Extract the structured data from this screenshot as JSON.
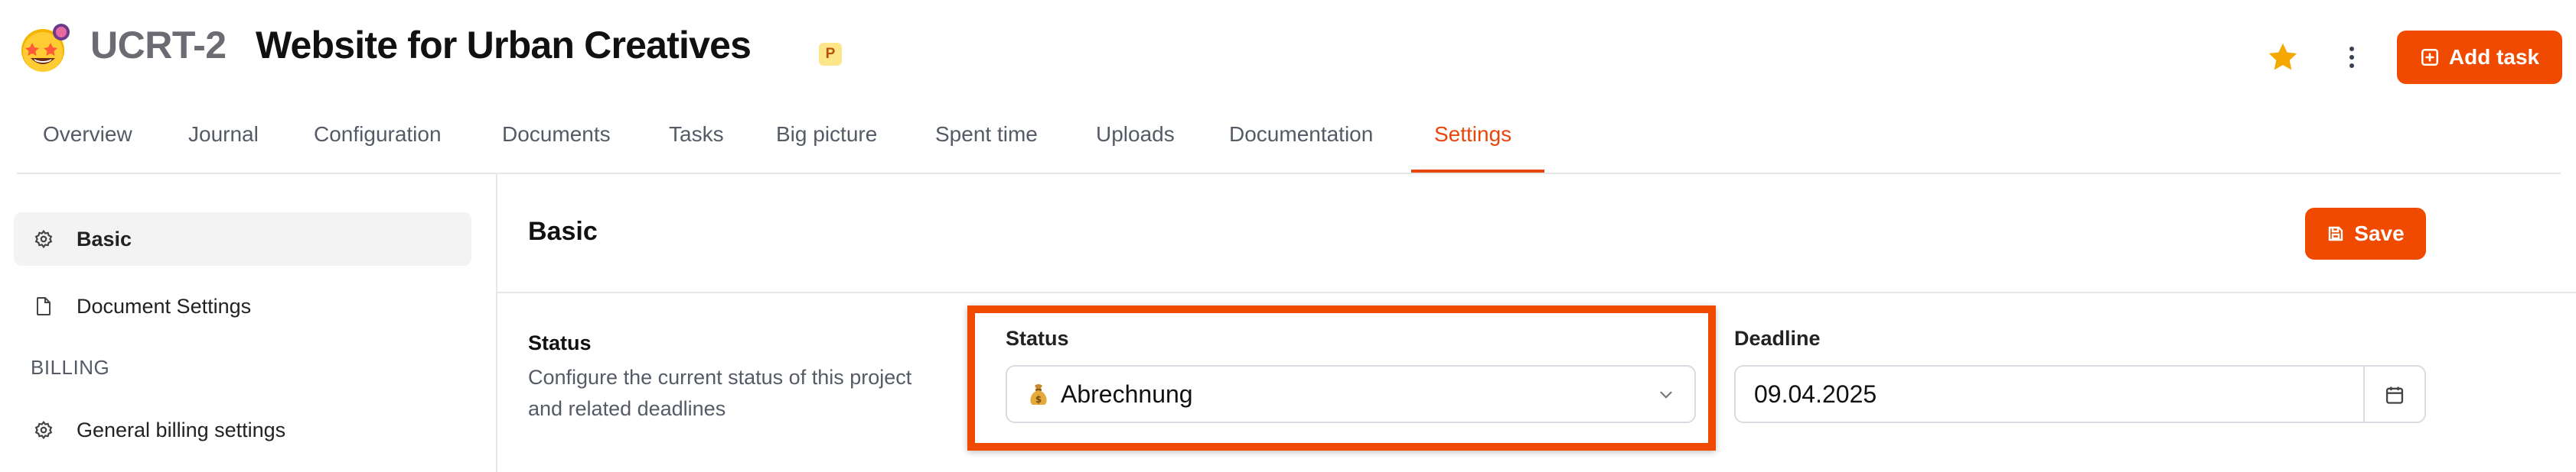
{
  "header": {
    "project_code": "UCRT-2",
    "project_name": "Website for Urban Creatives",
    "badge": "P",
    "avatar_icon": "star-struck-emoji",
    "favorite_icon": "star-icon",
    "more_icon": "kebab-menu-icon",
    "add_task_label": "Add task"
  },
  "tabs": [
    {
      "label": "Overview"
    },
    {
      "label": "Journal"
    },
    {
      "label": "Configuration"
    },
    {
      "label": "Documents"
    },
    {
      "label": "Tasks"
    },
    {
      "label": "Big picture"
    },
    {
      "label": "Spent time"
    },
    {
      "label": "Uploads"
    },
    {
      "label": "Documentation"
    },
    {
      "label": "Settings",
      "active": true
    }
  ],
  "sidebar": {
    "items": [
      {
        "label": "Basic",
        "icon": "gear-icon",
        "active": true
      },
      {
        "label": "Document Settings",
        "icon": "document-icon"
      }
    ],
    "section_billing": "BILLING",
    "billing_items": [
      {
        "label": "General billing settings",
        "icon": "gear-icon"
      }
    ]
  },
  "main": {
    "title": "Basic",
    "save_label": "Save",
    "status_section": {
      "title": "Status",
      "description": "Configure the current status of this project and related deadlines"
    },
    "status_field": {
      "label": "Status",
      "value": "Abrechnung",
      "icon": "money-bag-emoji"
    },
    "deadline_field": {
      "label": "Deadline",
      "value": "09.04.2025",
      "icon": "calendar-icon"
    }
  },
  "colors": {
    "accent": "#f04a00",
    "active_tab": "#e8470c",
    "highlight_border": "#f04a00"
  }
}
